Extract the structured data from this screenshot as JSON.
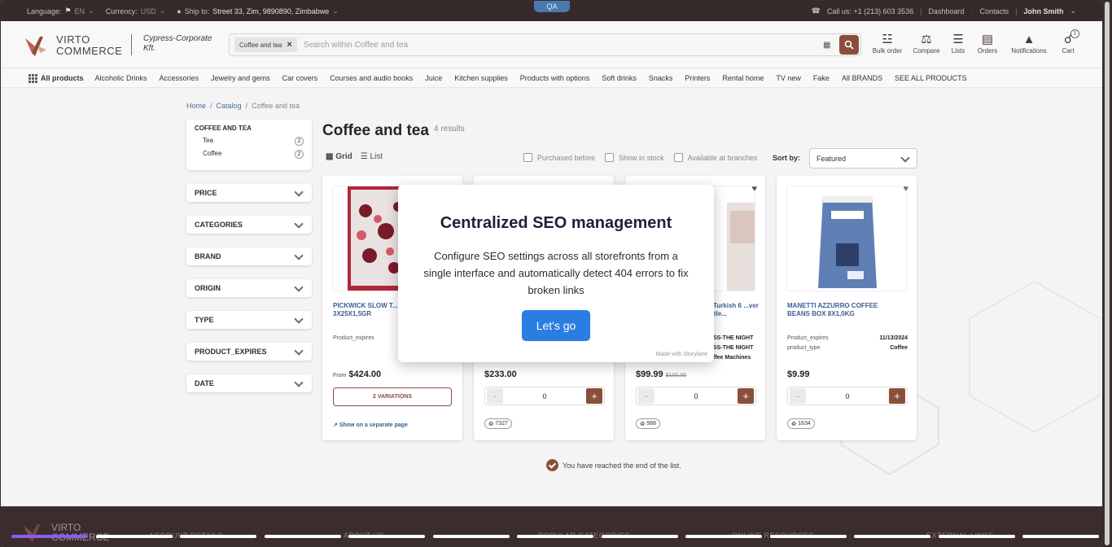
{
  "topbar": {
    "language_label": "Language:",
    "language_value": "EN",
    "currency_label": "Currency:",
    "currency_value": "USD",
    "ship_label": "Ship to:",
    "ship_value": "Street 33, Zim, 9890890, Zimbabwe",
    "qa_badge": "QA",
    "call_label": "Call us:",
    "call_value": "+1 (213) 603 3536",
    "dashboard": "Dashboard",
    "contacts": "Contacts",
    "user": "John Smith"
  },
  "header": {
    "logo_line1": "VIRTO",
    "logo_line2": "COMMERCE",
    "org_name": "Cypress-Corporate Kft.",
    "search_chip": "Coffee and tea",
    "search_placeholder": "Search within Coffee and tea",
    "icons": [
      {
        "label": "Bulk order",
        "icon": "bulk-order-icon"
      },
      {
        "label": "Compare",
        "icon": "compare-icon"
      },
      {
        "label": "Lists",
        "icon": "lists-icon"
      },
      {
        "label": "Orders",
        "icon": "orders-icon"
      },
      {
        "label": "Notifications",
        "icon": "notifications-icon"
      },
      {
        "label": "Cart",
        "icon": "cart-icon",
        "badge": "1"
      }
    ]
  },
  "catnav": {
    "all": "All products",
    "items": [
      "Alcoholic Drinks",
      "Accessories",
      "Jewelry and gems",
      "Car covers",
      "Courses and audio books",
      "Juice",
      "Kitchen supplies",
      "Products with options",
      "Soft drinks",
      "Snacks",
      "Printers",
      "Rental home",
      "TV new",
      "Fake",
      "All BRANDS",
      "SEE ALL PRODUCTS"
    ]
  },
  "breadcrumb": {
    "home": "Home",
    "catalog": "Catalog",
    "current": "Coffee and tea"
  },
  "sidebar": {
    "category_title": "COFFEE AND TEA",
    "categories": [
      {
        "label": "Tea",
        "count": "2"
      },
      {
        "label": "Coffee",
        "count": "2"
      }
    ],
    "facets": [
      "PRICE",
      "CATEGORIES",
      "BRAND",
      "ORIGIN",
      "TYPE",
      "PRODUCT_EXPIRES",
      "DATE"
    ]
  },
  "main": {
    "title": "Coffee and tea",
    "results": "4 results",
    "view_grid": "Grid",
    "view_list": "List",
    "filter_purchased": "Purchased before",
    "filter_stock": "Show in stock",
    "filter_branches": "Available at branches",
    "sort_label": "Sort by:",
    "sort_value": "Featured",
    "end_of_list": "You have reached the end of the list."
  },
  "products": [
    {
      "name": "PICKWICK SLOW T... BLUES 3X25X1,5GR",
      "prop1_label": "Product_expires",
      "prop1_value": "",
      "price_from": "From",
      "price": "$424.00",
      "variations": "2 VARIATIONS",
      "link": "Show on a separate page"
    },
    {
      "price": "$233.00",
      "qty": "0",
      "stock": "7327"
    },
    {
      "name": "...r Turkish 6 ...ver Kettle...",
      "prop1_value": "SS-THE NIGHT",
      "prop2_value": "SS-THE NIGHT",
      "prop3_value": "ffee Machines",
      "price": "$99.99",
      "old_price": "$100.00",
      "qty": "0",
      "stock": "988"
    },
    {
      "name": "MANETTI AZZURRO COFFEE BEANS BOX 8X1,0KG",
      "prop1_label": "Product_expires",
      "prop1_value": "11/13/2024",
      "prop2_label": "product_type",
      "prop2_value": "Coffee",
      "price": "$9.99",
      "qty": "0",
      "stock": "1634"
    }
  ],
  "modal": {
    "title": "Centralized SEO management",
    "body": "Configure SEO settings across all storefronts from a single interface and automatically detect 404 errors to fix broken links",
    "button": "Let's go",
    "made_with": "Made with Storylane"
  },
  "footer": {
    "logo_line1": "VIRTO",
    "logo_line2": "COMMERCE",
    "columns": [
      "ACCOUNT DETAILS",
      "ABOUT US",
      "POPULAR CATEGORIES",
      "ONLINE RESOURCES",
      "EXTERNAL LINKS"
    ]
  },
  "colors": {
    "brand": "#8a4f3a",
    "topbar": "#36292a",
    "cta": "#2a7de1"
  }
}
